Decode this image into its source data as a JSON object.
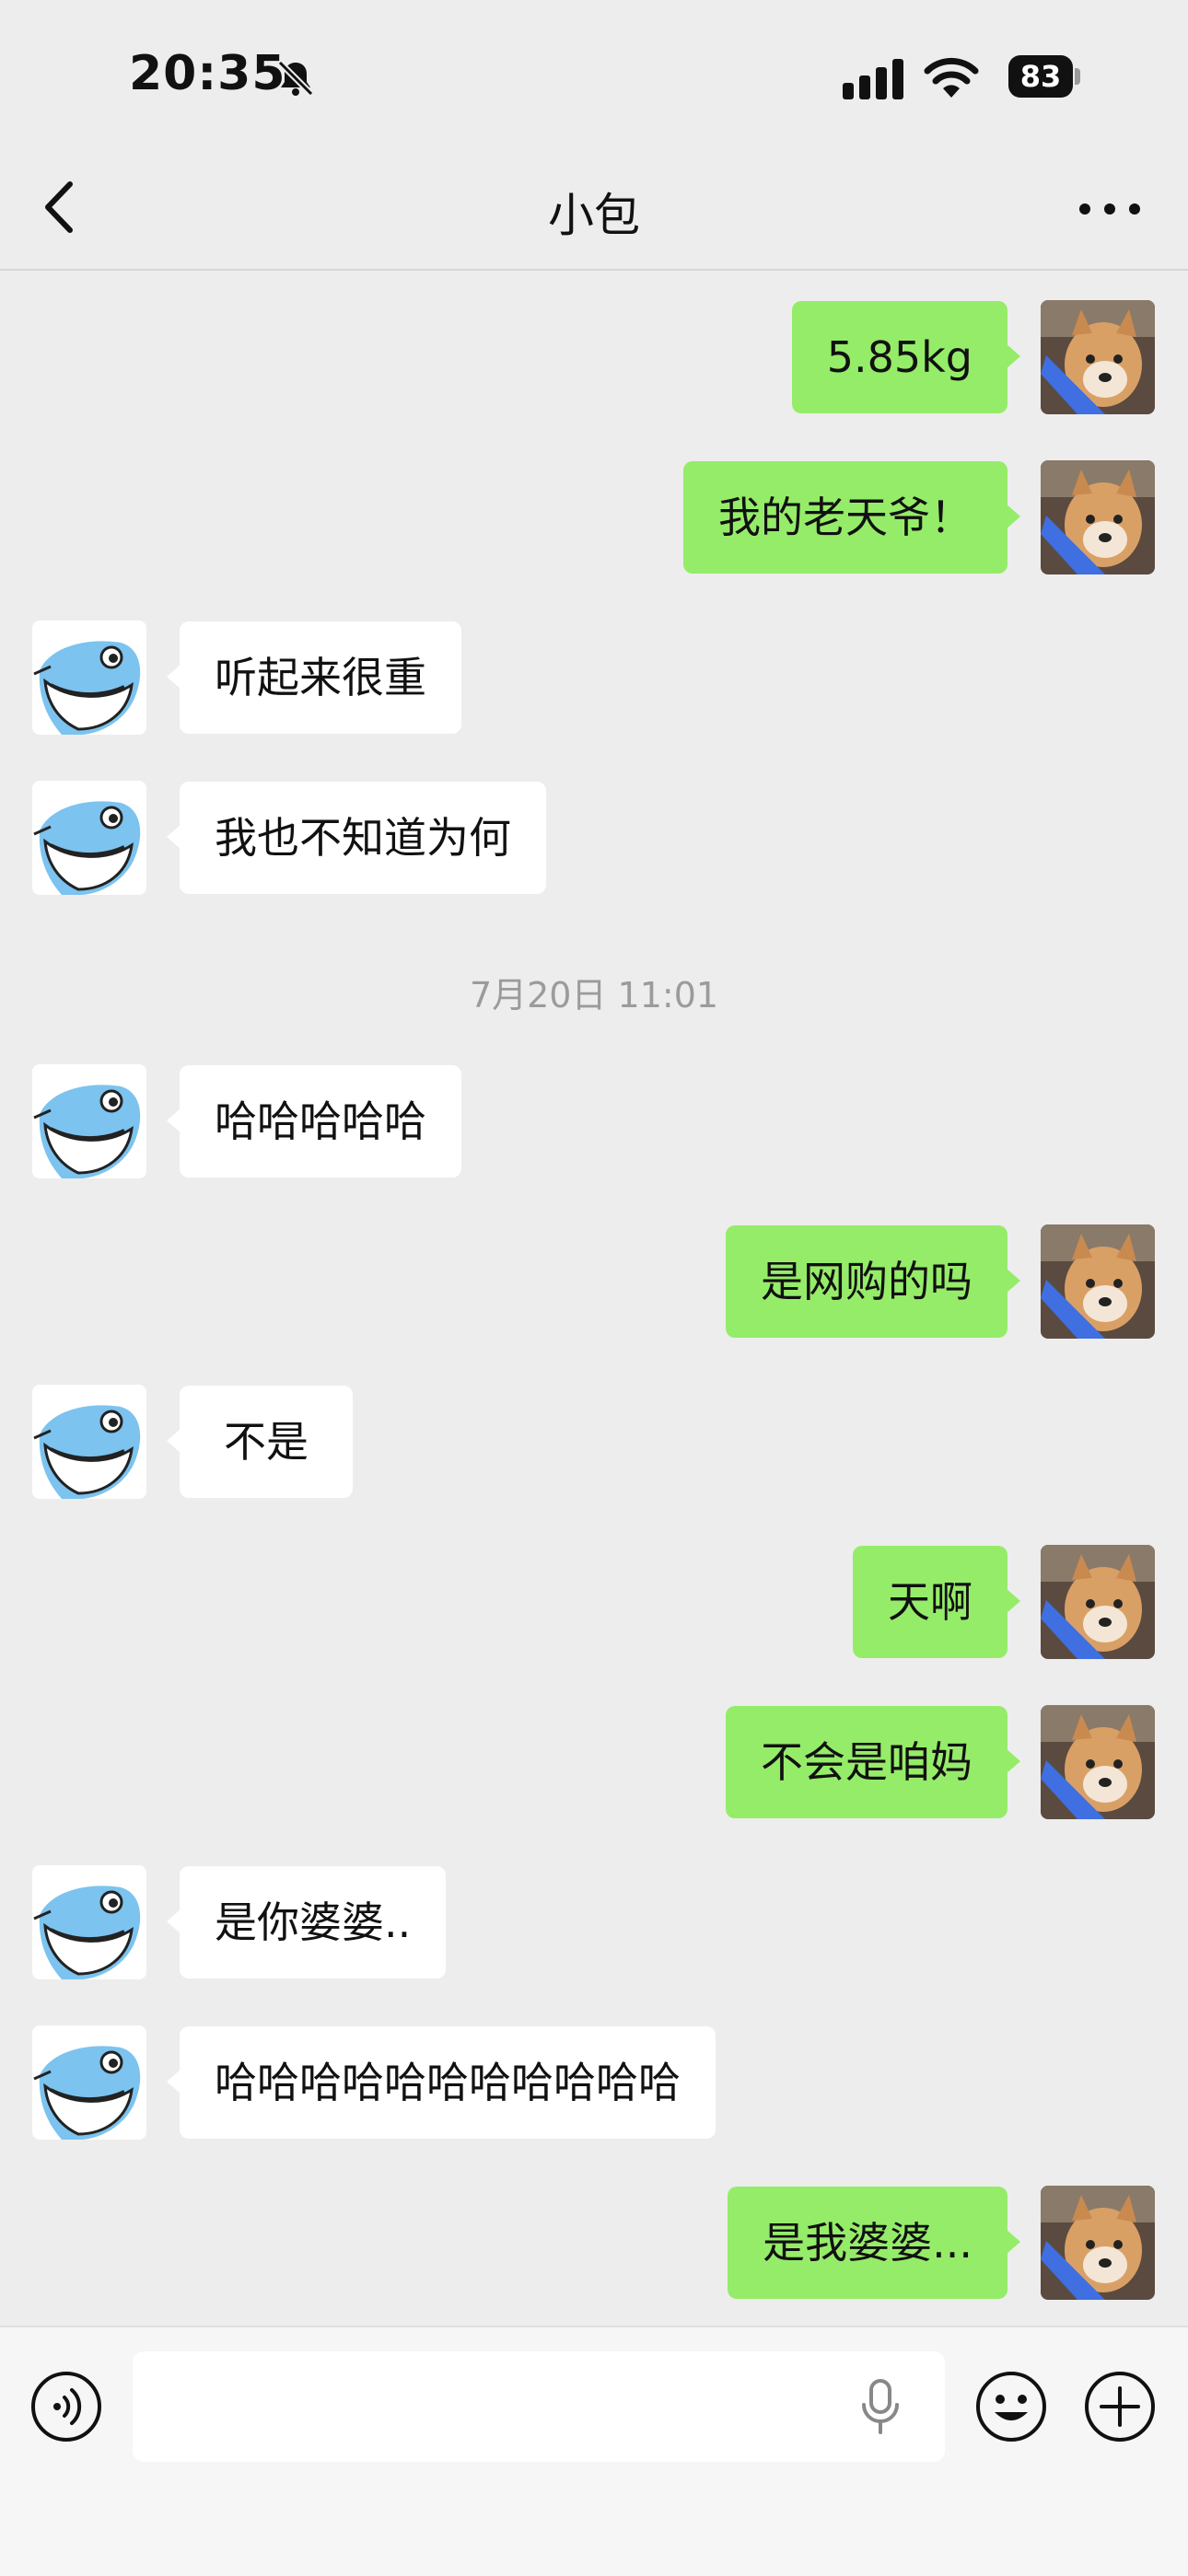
{
  "status_bar": {
    "time": "20:35",
    "battery": "83"
  },
  "nav": {
    "title": "小包"
  },
  "messages": [
    {
      "side": "out",
      "text": "5.85kg"
    },
    {
      "side": "out",
      "text": "我的老天爷！"
    },
    {
      "side": "in",
      "text": "听起来很重"
    },
    {
      "side": "in",
      "text": "我也不知道为何"
    },
    {
      "type": "timestamp",
      "text": "7月20日 11:01"
    },
    {
      "side": "in",
      "text": "哈哈哈哈哈"
    },
    {
      "side": "out",
      "text": "是网购的吗"
    },
    {
      "side": "in",
      "text": "不是"
    },
    {
      "side": "out",
      "text": "天啊"
    },
    {
      "side": "out",
      "text": "不会是咱妈"
    },
    {
      "side": "in",
      "text": "是你婆婆.."
    },
    {
      "side": "in",
      "text": "哈哈哈哈哈哈哈哈哈哈哈"
    },
    {
      "side": "out",
      "text": "是我婆婆..."
    }
  ],
  "colors": {
    "outgoing_bubble": "#95ec69",
    "incoming_bubble": "#ffffff",
    "background": "#ededed"
  },
  "icons": {
    "mute": "bell-slash-icon",
    "back": "chevron-left-icon",
    "more": "ellipsis-icon",
    "voice": "voice-wave-icon",
    "mic": "microphone-icon",
    "emoji": "smiley-icon",
    "add": "plus-circle-icon"
  }
}
